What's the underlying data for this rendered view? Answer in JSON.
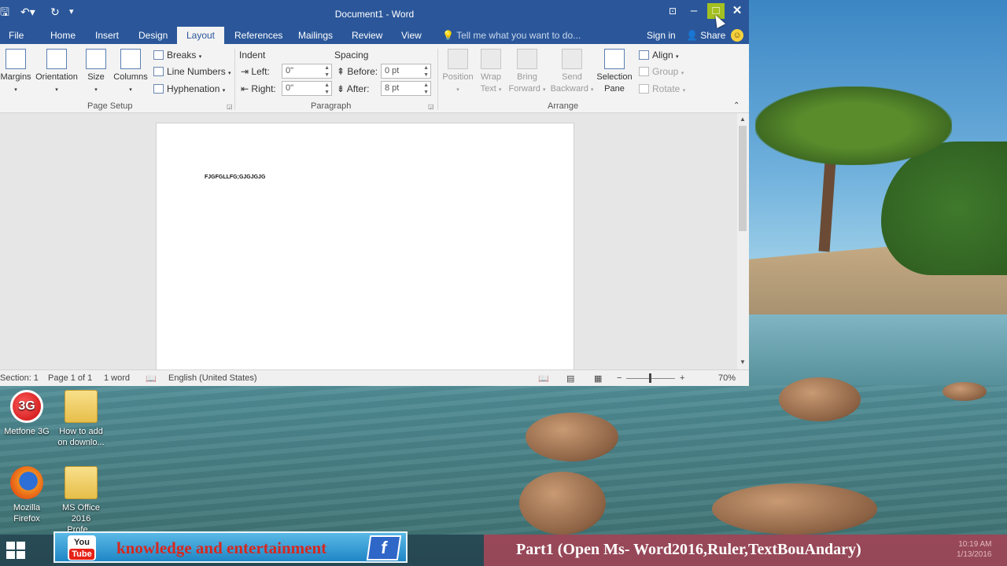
{
  "titlebar": {
    "title": "Document1 - Word",
    "qat": {
      "save": "🖫",
      "undo": "↶▾",
      "redo": "↻",
      "customize": "▾"
    }
  },
  "tabs": [
    {
      "label": "File"
    },
    {
      "label": "Home"
    },
    {
      "label": "Insert"
    },
    {
      "label": "Design"
    },
    {
      "label": "Layout",
      "active": true
    },
    {
      "label": "References"
    },
    {
      "label": "Mailings"
    },
    {
      "label": "Review"
    },
    {
      "label": "View"
    }
  ],
  "tell_me": "Tell me what you want to do...",
  "sign_in": "Sign in",
  "share": "Share",
  "page_setup": {
    "margins": "Margins",
    "orientation": "Orientation",
    "size": "Size",
    "columns": "Columns",
    "breaks": "Breaks",
    "line_numbers": "Line Numbers",
    "hyphenation": "Hyphenation",
    "group_label": "Page Setup"
  },
  "paragraph": {
    "indent_title": "Indent",
    "spacing_title": "Spacing",
    "left_label": "Left:",
    "right_label": "Right:",
    "before_label": "Before:",
    "after_label": "After:",
    "left_value": "0\"",
    "right_value": "0\"",
    "before_value": "0 pt",
    "after_value": "8 pt",
    "group_label": "Paragraph"
  },
  "arrange": {
    "position": "Position",
    "wrap_text_1": "Wrap",
    "wrap_text_2": "Text",
    "bring_forward_1": "Bring",
    "bring_forward_2": "Forward",
    "send_backward_1": "Send",
    "send_backward_2": "Backward",
    "selection_pane_1": "Selection",
    "selection_pane_2": "Pane",
    "align": "Align",
    "group": "Group",
    "rotate": "Rotate",
    "group_label": "Arrange"
  },
  "document": {
    "text": "FJGFGLLFG;GJGJGJG"
  },
  "status": {
    "section": "Section: 1",
    "page": "Page 1 of 1",
    "words": "1 word",
    "language": "English (United States)",
    "zoom": "70%"
  },
  "desktop_icons": [
    {
      "label_1": "Metfone 3G",
      "label_2": ""
    },
    {
      "label_1": "How to add",
      "label_2": "on downlo..."
    },
    {
      "label_1": "Mozilla",
      "label_2": "Firefox"
    },
    {
      "label_1": "MS Office",
      "label_2": "2016 Profe..."
    }
  ],
  "banner": {
    "youtube_top": "You",
    "youtube_bottom": "Tube",
    "text": "knowledge and entertainment",
    "fb_letter": "f"
  },
  "caption": "Part1 (Open Ms- Word2016,Ruler,TextBouAndary)",
  "clock": {
    "time": "10:19 AM",
    "date": "1/13/2016"
  }
}
